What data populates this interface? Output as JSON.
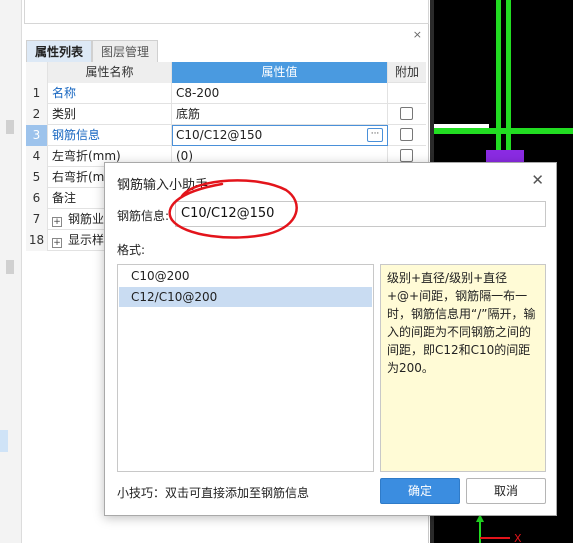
{
  "panel": {
    "tabs": [
      {
        "label": "属性列表",
        "active": true
      },
      {
        "label": "图层管理",
        "active": false
      }
    ],
    "close_symbol": "×",
    "columns": {
      "name": "属性名称",
      "value": "属性值",
      "add": "附加"
    },
    "rows": [
      {
        "num": "1",
        "name": "名称",
        "value": "C8-200",
        "checkbox": false
      },
      {
        "num": "2",
        "name": "类别",
        "value": "底筋",
        "checkbox": true
      },
      {
        "num": "3",
        "name": "钢筋信息",
        "value": "C10/C12@150",
        "checkbox": true
      },
      {
        "num": "4",
        "name": "左弯折(mm)",
        "value": "(0)",
        "checkbox": true
      },
      {
        "num": "5",
        "name": "右弯折(m",
        "value": "",
        "checkbox": false
      },
      {
        "num": "6",
        "name": "备注",
        "value": "",
        "checkbox": false
      },
      {
        "num": "7",
        "name": "钢筋业",
        "value": "",
        "checkbox": false
      },
      {
        "num": "18",
        "name": "显示样",
        "value": "",
        "checkbox": false
      }
    ],
    "ellipsis": "···",
    "expand_symbol": "+"
  },
  "dialog": {
    "title": "钢筋输入小助手",
    "close_symbol": "✕",
    "rebar_label": "钢筋信息:",
    "rebar_value": "C10/C12@150",
    "format_label": "格式:",
    "formats": [
      {
        "text": "C10@200",
        "selected": false
      },
      {
        "text": "C12/C10@200",
        "selected": true
      }
    ],
    "help_text": "级别+直径/级别+直径+@+间距，钢筋隔一布一时，钢筋信息用“/”隔开，输入的间距为不同钢筋之间的间距，即C12和C10的间距为200。",
    "tip": "小技巧：双击可直接添加至钢筋信息",
    "ok_label": "确定",
    "cancel_label": "取消"
  },
  "colors": {
    "accent": "#3b8de0",
    "header_blue": "#4a9ae0",
    "link_blue": "#1565c0",
    "help_bg": "#fffbd6",
    "canvas_bg": "#000000",
    "canvas_green": "#22dd22",
    "canvas_purple": "#8a2be2",
    "annotation_red": "#e3141b"
  },
  "canvas": {
    "axis_x_label": "X"
  }
}
